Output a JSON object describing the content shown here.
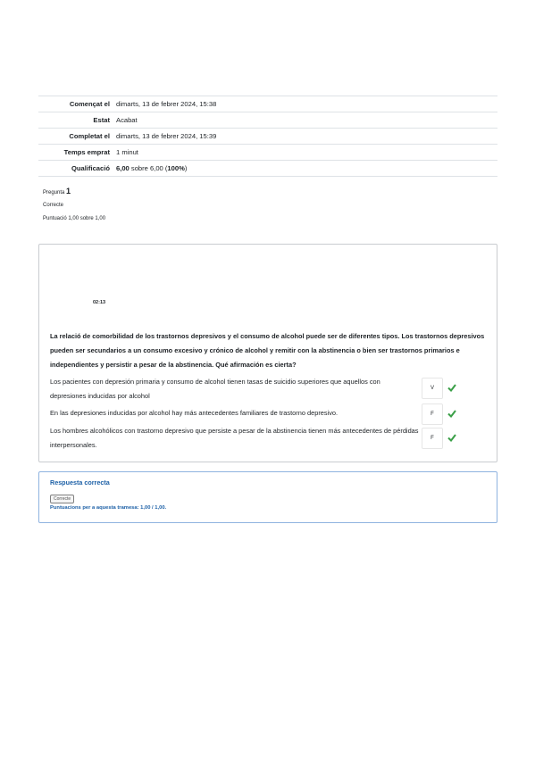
{
  "summary": {
    "rows": [
      {
        "label": "Començat el",
        "value": "dimarts, 13 de febrer 2024, 15:38"
      },
      {
        "label": "Estat",
        "value": "Acabat"
      },
      {
        "label": "Completat el",
        "value": "dimarts, 13 de febrer 2024, 15:39"
      },
      {
        "label": "Temps emprat",
        "value": "1 minut"
      },
      {
        "label": "Qualificació",
        "value_bold": "6,00",
        "value_mid": " sobre 6,00 (",
        "value_pct": "100%",
        "value_end": ")"
      }
    ]
  },
  "question": {
    "prefix": "Pregunta",
    "number": "1",
    "state": "Correcte",
    "grade": "Puntuació 1,00 sobre 1,00",
    "timer": "02:13",
    "text": "La relació de comorbilidad de los trastornos depresivos y el consumo de alcohol puede ser de diferentes tipos. Los trastornos depresivos pueden ser secundarios a un consumo excesivo y crónico de alcohol y remitir con la abstinencia o bien ser trastornos primarios e independientes y persistir a pesar de la abstinencia. Qué afirmación es cierta?",
    "statements": [
      {
        "text": "Los pacientes con depresión primaria y consumo de alcohol tienen tasas de suicidio superiores que aquellos con depresiones inducidas por alcohol",
        "answer": "V"
      },
      {
        "text": "En las depresiones inducidas por alcohol hay más antecedentes familiares de trastorno depresivo.",
        "answer": "F"
      },
      {
        "text": "Los hombres alcohólicos con trastorno depresivo que persiste a pesar de la abstinencia tienen más antecedentes de pérdidas interpersonales.",
        "answer": "F"
      }
    ]
  },
  "feedback": {
    "title": "Respuesta correcta",
    "badge": "Correcte",
    "score": "Puntuacions per a aquesta tramesa: 1,00 / 1,00."
  },
  "colors": {
    "accent": "#1b5fa6",
    "check": "#3a9f47"
  }
}
